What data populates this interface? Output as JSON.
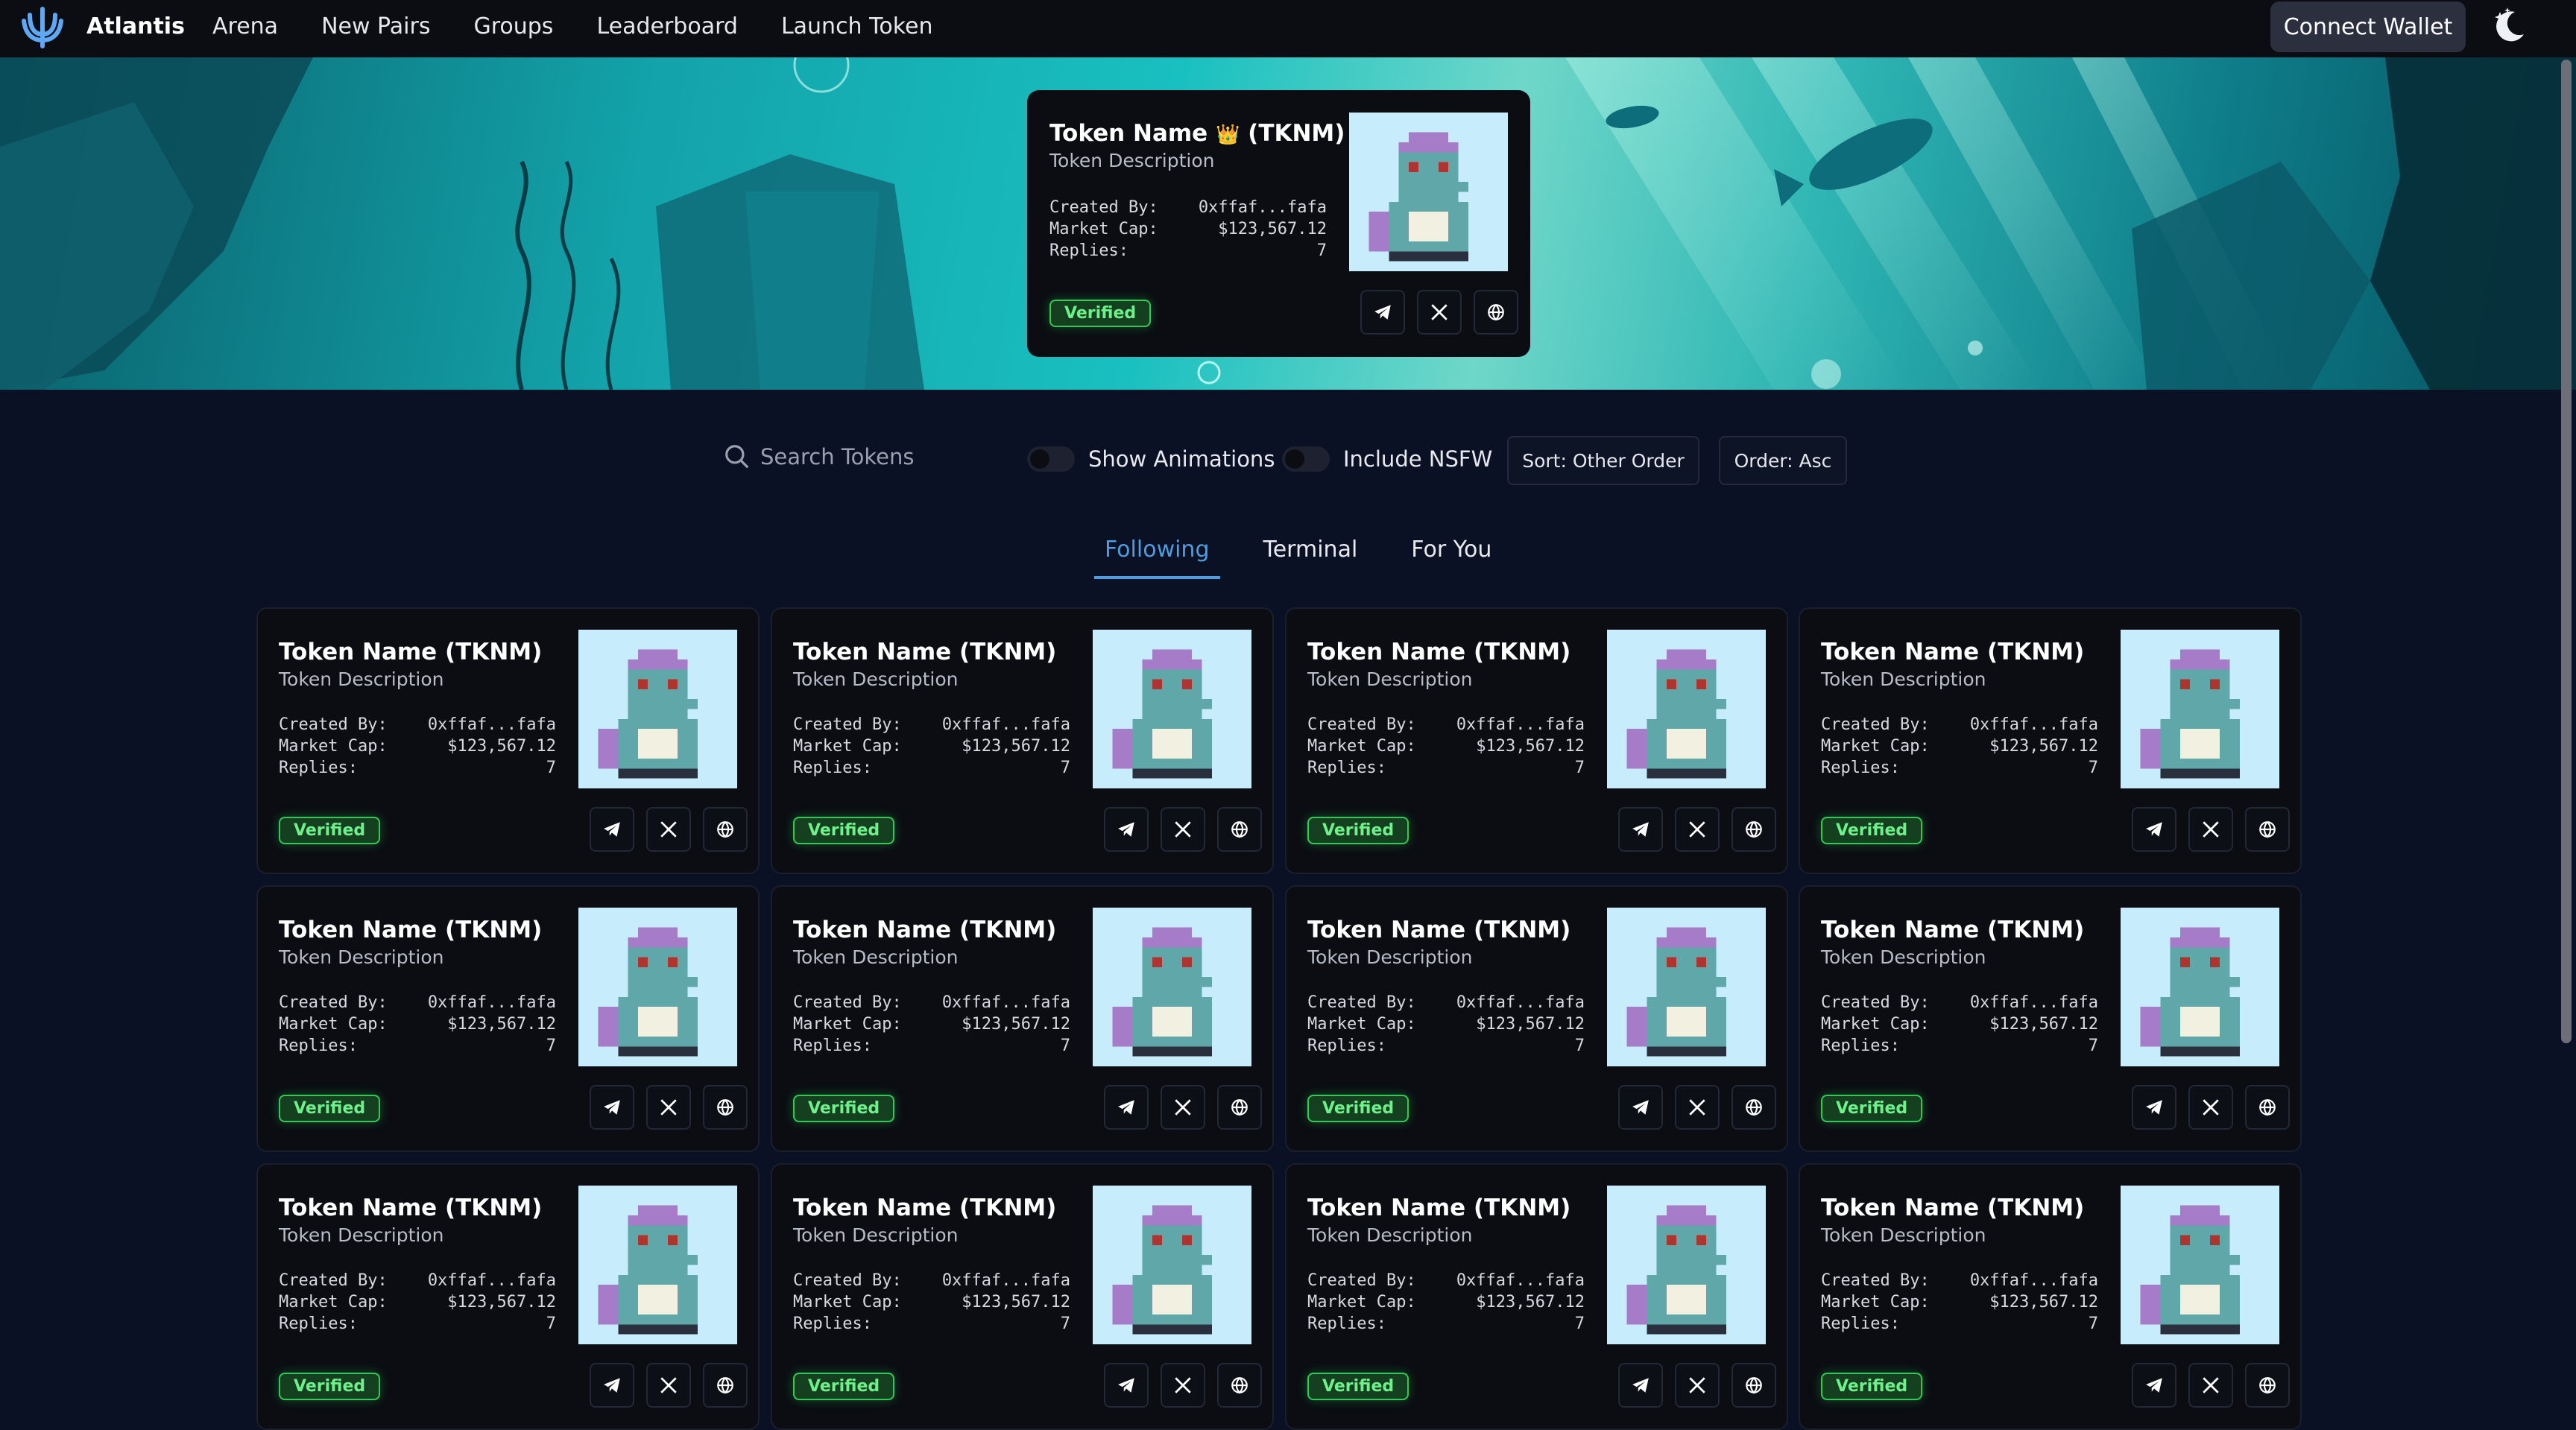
{
  "nav": {
    "brand": "Atlantis",
    "links": [
      "Arena",
      "New Pairs",
      "Groups",
      "Leaderboard",
      "Launch Token"
    ],
    "connect_label": "Connect Wallet"
  },
  "featured": {
    "name": "Token Name",
    "crown": "👑",
    "symbol": "(TKNM)",
    "description": "Token Description",
    "created_by_label": "Created By:",
    "created_by": "0xffaf...fafa",
    "market_cap_label": "Market Cap:",
    "market_cap": "$123,567.12",
    "replies_label": "Replies:",
    "replies": "7",
    "badge": "Verified"
  },
  "filters": {
    "search_placeholder": "Search Tokens",
    "show_animations": "Show Animations",
    "include_nsfw": "Include NSFW",
    "sort": "Sort: Other Order",
    "order": "Order: Asc"
  },
  "tabs": [
    "Following",
    "Terminal",
    "For You"
  ],
  "tokens": [
    {
      "name": "Token Name (TKNM)",
      "description": "Token Description",
      "created_by_label": "Created By:",
      "created_by": "0xffaf...fafa",
      "market_cap_label": "Market Cap:",
      "market_cap": "$123,567.12",
      "replies_label": "Replies:",
      "replies": "7",
      "badge": "Verified"
    },
    {
      "name": "Token Name (TKNM)",
      "description": "Token Description",
      "created_by_label": "Created By:",
      "created_by": "0xffaf...fafa",
      "market_cap_label": "Market Cap:",
      "market_cap": "$123,567.12",
      "replies_label": "Replies:",
      "replies": "7",
      "badge": "Verified"
    },
    {
      "name": "Token Name (TKNM)",
      "description": "Token Description",
      "created_by_label": "Created By:",
      "created_by": "0xffaf...fafa",
      "market_cap_label": "Market Cap:",
      "market_cap": "$123,567.12",
      "replies_label": "Replies:",
      "replies": "7",
      "badge": "Verified"
    },
    {
      "name": "Token Name (TKNM)",
      "description": "Token Description",
      "created_by_label": "Created By:",
      "created_by": "0xffaf...fafa",
      "market_cap_label": "Market Cap:",
      "market_cap": "$123,567.12",
      "replies_label": "Replies:",
      "replies": "7",
      "badge": "Verified"
    },
    {
      "name": "Token Name (TKNM)",
      "description": "Token Description",
      "created_by_label": "Created By:",
      "created_by": "0xffaf...fafa",
      "market_cap_label": "Market Cap:",
      "market_cap": "$123,567.12",
      "replies_label": "Replies:",
      "replies": "7",
      "badge": "Verified"
    },
    {
      "name": "Token Name (TKNM)",
      "description": "Token Description",
      "created_by_label": "Created By:",
      "created_by": "0xffaf...fafa",
      "market_cap_label": "Market Cap:",
      "market_cap": "$123,567.12",
      "replies_label": "Replies:",
      "replies": "7",
      "badge": "Verified"
    },
    {
      "name": "Token Name (TKNM)",
      "description": "Token Description",
      "created_by_label": "Created By:",
      "created_by": "0xffaf...fafa",
      "market_cap_label": "Market Cap:",
      "market_cap": "$123,567.12",
      "replies_label": "Replies:",
      "replies": "7",
      "badge": "Verified"
    },
    {
      "name": "Token Name (TKNM)",
      "description": "Token Description",
      "created_by_label": "Created By:",
      "created_by": "0xffaf...fafa",
      "market_cap_label": "Market Cap:",
      "market_cap": "$123,567.12",
      "replies_label": "Replies:",
      "replies": "7",
      "badge": "Verified"
    },
    {
      "name": "Token Name (TKNM)",
      "description": "Token Description",
      "created_by_label": "Created By:",
      "created_by": "0xffaf...fafa",
      "market_cap_label": "Market Cap:",
      "market_cap": "$123,567.12",
      "replies_label": "Replies:",
      "replies": "7",
      "badge": "Verified"
    },
    {
      "name": "Token Name (TKNM)",
      "description": "Token Description",
      "created_by_label": "Created By:",
      "created_by": "0xffaf...fafa",
      "market_cap_label": "Market Cap:",
      "market_cap": "$123,567.12",
      "replies_label": "Replies:",
      "replies": "7",
      "badge": "Verified"
    },
    {
      "name": "Token Name (TKNM)",
      "description": "Token Description",
      "created_by_label": "Created By:",
      "created_by": "0xffaf...fafa",
      "market_cap_label": "Market Cap:",
      "market_cap": "$123,567.12",
      "replies_label": "Replies:",
      "replies": "7",
      "badge": "Verified"
    },
    {
      "name": "Token Name (TKNM)",
      "description": "Token Description",
      "created_by_label": "Created By:",
      "created_by": "0xffaf...fafa",
      "market_cap_label": "Market Cap:",
      "market_cap": "$123,567.12",
      "replies_label": "Replies:",
      "replies": "7",
      "badge": "Verified"
    }
  ],
  "icons": {
    "logo": "trident-logo-icon",
    "theme": "moon-stars-icon",
    "search": "search-icon",
    "socials": [
      "telegram-icon",
      "x-icon",
      "globe-icon"
    ]
  },
  "colors": {
    "accent": "#4d9de0",
    "verified": "#2ecc55",
    "card_bg": "#0b0d12",
    "page_bg": "#0a1124"
  }
}
